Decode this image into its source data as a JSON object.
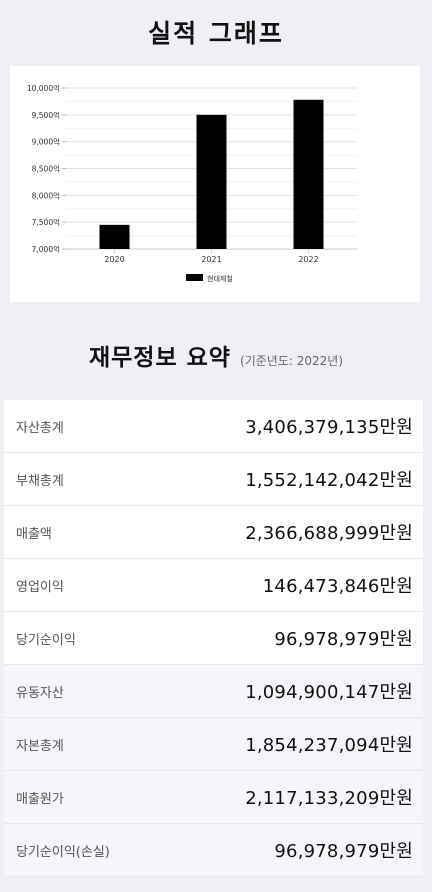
{
  "page_title": "실적 그래프",
  "chart_data": {
    "type": "bar",
    "categories": [
      "2020",
      "2021",
      "2022"
    ],
    "series": [
      {
        "name": "현대제철",
        "values": [
          7450,
          9500,
          9780
        ],
        "color": "#000000"
      }
    ],
    "ylim": [
      7000,
      10000
    ],
    "y_ticks": [
      "7,000억",
      "7,500억",
      "8,000억",
      "8,500억",
      "9,000억",
      "9,500억",
      "10,000억"
    ],
    "y_tick_values": [
      7000,
      7500,
      8000,
      8500,
      9000,
      9500,
      10000
    ],
    "grid": true,
    "legend_position": "bottom"
  },
  "summary": {
    "title": "재무정보 요약",
    "subtitle": "(기준년도: 2022년)",
    "rows": [
      {
        "label": "자산총계",
        "value": "3,406,379,135만원"
      },
      {
        "label": "부채총계",
        "value": "1,552,142,042만원"
      },
      {
        "label": "매출액",
        "value": "2,366,688,999만원"
      },
      {
        "label": "영업이익",
        "value": "146,473,846만원"
      },
      {
        "label": "당기순이익",
        "value": "96,978,979만원"
      },
      {
        "label": "유동자산",
        "value": "1,094,900,147만원"
      },
      {
        "label": "자본총계",
        "value": "1,854,237,094만원"
      },
      {
        "label": "매출원가",
        "value": "2,117,133,209만원"
      },
      {
        "label": "당기순이익(손실)",
        "value": "96,978,979만원"
      }
    ]
  }
}
